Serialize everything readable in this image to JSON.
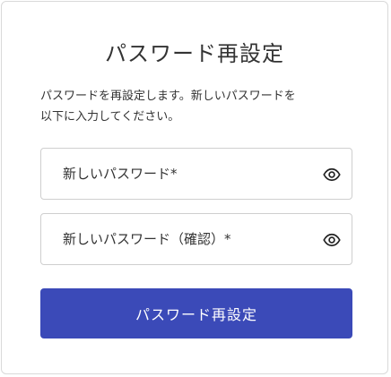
{
  "page": {
    "title": "パスワード再設定",
    "description_lines": [
      "パスワードを再設定します。新しいパスワードを",
      "以下に入力してください。"
    ]
  },
  "form": {
    "new_password": {
      "placeholder": "新しいパスワード*",
      "value": "",
      "icon": "eye-icon"
    },
    "confirm_password": {
      "placeholder": "新しいパスワード（確認）*",
      "value": "",
      "icon": "eye-icon"
    },
    "submit_label": "パスワード再設定"
  },
  "colors": {
    "accent": "#3b4ab8",
    "text": "#333333",
    "border": "#cfcfcf"
  }
}
